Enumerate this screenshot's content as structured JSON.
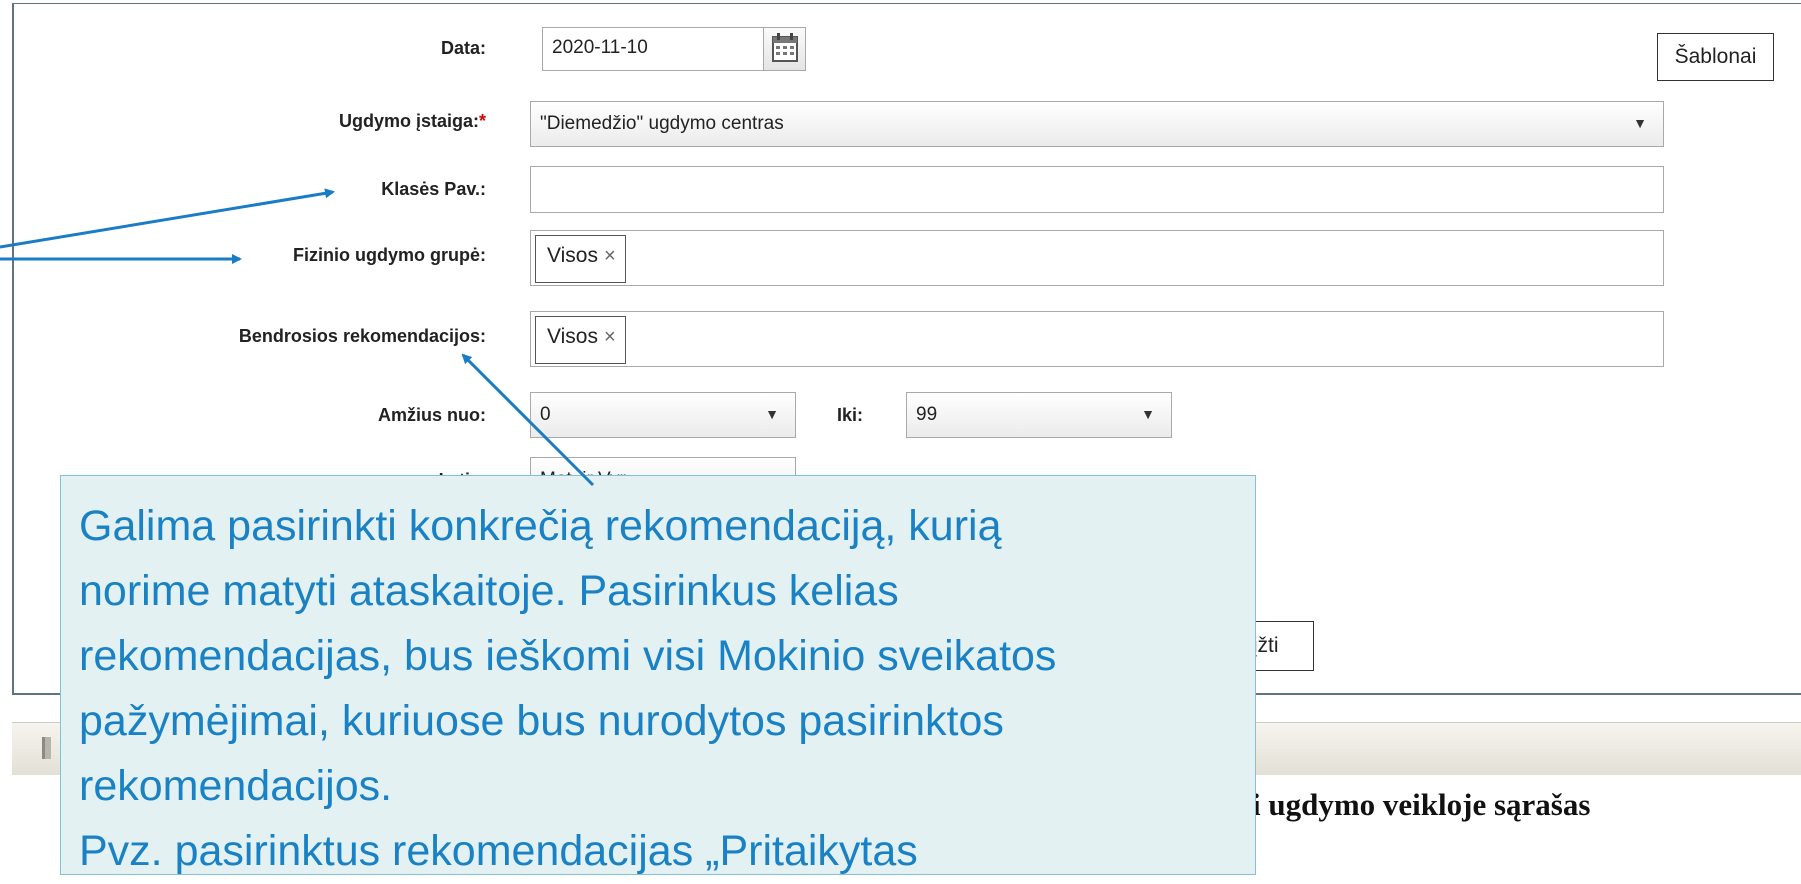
{
  "form": {
    "date_label": "Data:",
    "date_value": "2020-11-10",
    "school_label": "Ugdymo įstaiga:",
    "school_required_mark": "*",
    "school_value": "\"Diemedžio\" ugdymo centras",
    "class_label": "Klasės Pav.:",
    "class_value": "",
    "pe_group_label": "Fizinio ugdymo grupė:",
    "pe_group_tag": "Visos",
    "recommendations_label": "Bendrosios rekomendacijos:",
    "recommendations_tag": "Visos",
    "age_from_label": "Amžius nuo:",
    "age_from_value": "0",
    "age_to_label": "Iki:",
    "age_to_value": "99",
    "gender_label": "Lytis:",
    "gender_value": "Mot. ir Vyr.",
    "templates_button": "Šablonai",
    "back_button": "Grįžti",
    "remove_glyph": "×",
    "dropdown_glyph": "▼"
  },
  "report_heading": "i ugdymo veikloje sąrašas",
  "callout": {
    "lines": [
      "Galima pasirinkti konkrečią rekomendaciją, kurią",
      "norime matyti ataskaitoje. Pasirinkus kelias",
      "rekomendacijas, bus ieškomi visi Mokinio sveikatos",
      "pažymėjimai, kuriuose bus nurodytos pasirinktos",
      "rekomendacijos.",
      "Pvz. pasirinktus rekomendacijas „Pritaikytas"
    ]
  },
  "colors": {
    "arrow": "#1a7cc4",
    "callout_bg": "#e3f1f3",
    "callout_text": "#1a82c4",
    "required": "#d40000"
  }
}
